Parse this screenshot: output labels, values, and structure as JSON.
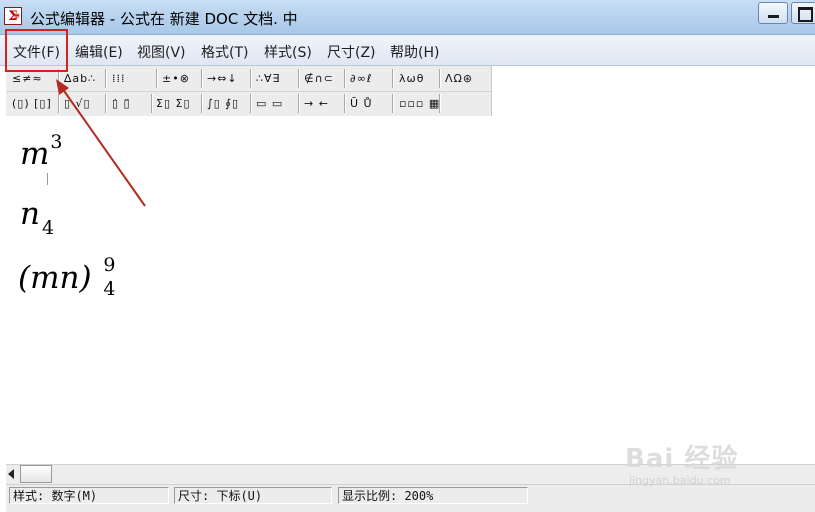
{
  "window": {
    "title": "公式编辑器 - 公式在 新建 DOC 文档. 中",
    "icon_glyph": "Σ",
    "icon_sub": "≡"
  },
  "menu": [
    {
      "label": "文件(F)",
      "name": "menu-file"
    },
    {
      "label": "编辑(E)",
      "name": "menu-edit"
    },
    {
      "label": "视图(V)",
      "name": "menu-view"
    },
    {
      "label": "格式(T)",
      "name": "menu-format"
    },
    {
      "label": "样式(S)",
      "name": "menu-style"
    },
    {
      "label": "尺寸(Z)",
      "name": "menu-size"
    },
    {
      "label": "帮助(H)",
      "name": "menu-help"
    }
  ],
  "toolbar": {
    "row1": [
      "≤≠≈",
      "∆ab∴",
      "⁞⁞⁞",
      "±•⊗",
      "→⇔↓",
      "∴∀∃",
      "∉∩⊂",
      "∂∞ℓ",
      "λωθ",
      "ΛΩ⊛"
    ],
    "row2": [
      "(▯) [▯]",
      "▯ √▯",
      "▯̇ ▯̈",
      "Σ▯ Σ▯",
      "∫▯ ∮▯",
      "▭ ▭",
      "→ ←",
      "Ū Ů",
      "▫▫▫ ▦"
    ]
  },
  "equations": [
    {
      "base": "m",
      "sup": "3",
      "sub": ""
    },
    {
      "base": "n",
      "sup": "",
      "sub": "4"
    },
    {
      "base": "(mn)",
      "sup": "9",
      "sub": "4"
    }
  ],
  "status": {
    "style": "样式: 数字(M)",
    "size": "尺寸: 下标(U)",
    "zoom": "显示比例: 200%"
  },
  "watermark": {
    "main": "Bai 经验",
    "sub": "jingyan.baidu.com"
  },
  "colors": {
    "annotation_red": "#d4231c",
    "titlebar": "#b8d3ee"
  }
}
